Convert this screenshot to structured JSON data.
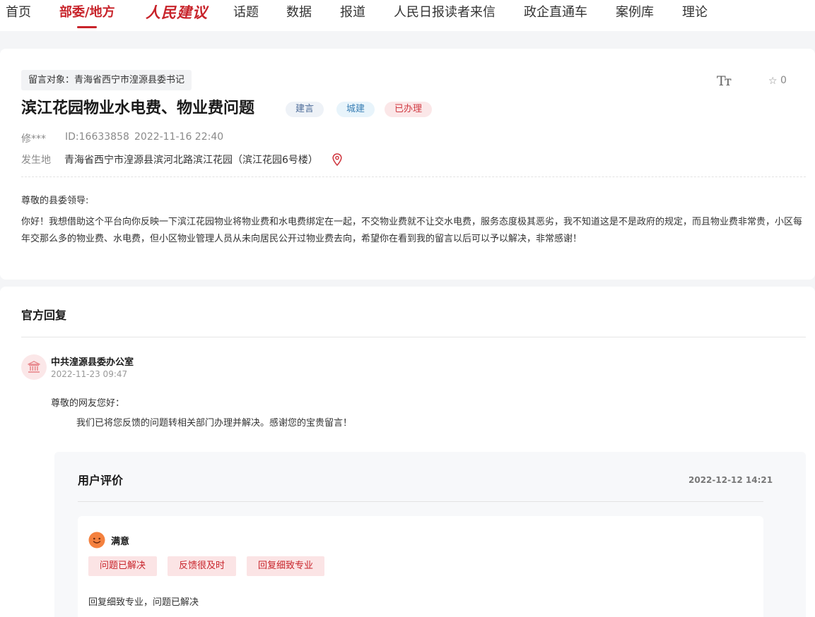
{
  "nav": {
    "items": [
      "首页",
      "部委/地方",
      "话题",
      "数据",
      "报道",
      "人民日报读者来信",
      "政企直通车",
      "案例库",
      "理论"
    ],
    "brand": "人民建议",
    "accent": "#c8242b"
  },
  "message": {
    "target": "留言对象：青海省西宁市湟源县委书记",
    "font_icon": "Tт",
    "favorite_count": "0",
    "title": "滨江花园物业水电费、物业费问题",
    "badges": [
      "建言",
      "城建",
      "已办理"
    ],
    "author": "修***",
    "id": "ID:16633858",
    "time": "2022-11-16 22:40",
    "location_label": "发生地",
    "location": "青海省西宁市湟源县滨河北路滨江花园（滨江花园6号楼）",
    "greeting": "尊敬的县委领导:",
    "body": "你好！我想借助这个平台向你反映一下滨江花园物业将物业费和水电费绑定在一起，不交物业费就不让交水电费，服务态度极其恶劣，我不知道这是不是政府的规定，而且物业费非常贵，小区每年交那么多的物业费、水电费，但小区物业管理人员从未向居民公开过物业费去向，希望你在看到我的留言以后可以予以解决，非常感谢！"
  },
  "reply": {
    "heading": "官方回复",
    "office": "中共湟源县委办公室",
    "time": "2022-11-23 09:47",
    "greeting": "尊敬的网友您好：",
    "content": "我们已将您反馈的问题转相关部门办理并解决。感谢您的宝贵留言！"
  },
  "evaluation": {
    "heading": "用户评价",
    "time": "2022-12-12 14:21",
    "satisfaction": "满意",
    "tags": [
      "问题已解决",
      "反馈很及时",
      "回复细致专业"
    ],
    "comment": "回复细致专业，问题已解决"
  }
}
